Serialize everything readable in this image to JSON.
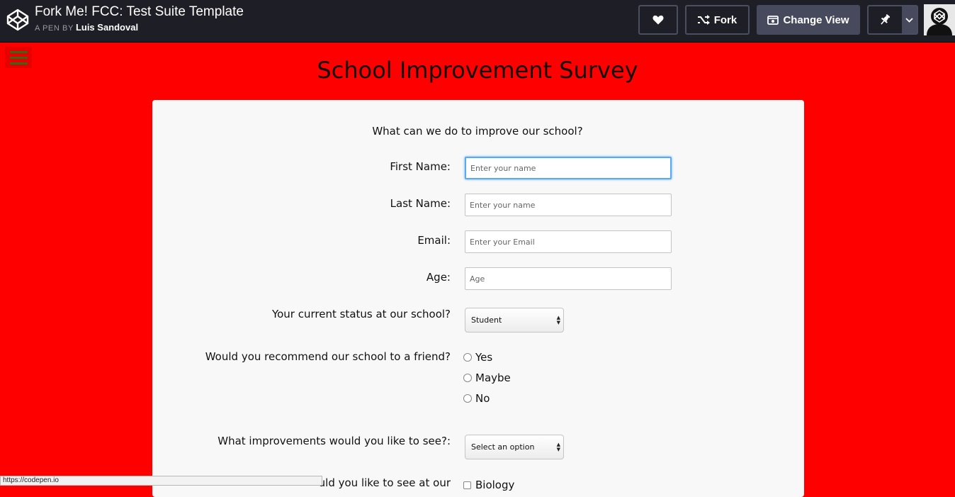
{
  "codepen": {
    "pen_title": "Fork Me! FCC: Test Suite Template",
    "by_prefix": "A PEN BY",
    "author": "Luis Sandoval",
    "fork_label": "Fork",
    "change_view_label": "Change View"
  },
  "survey": {
    "title": "School Improvement Survey",
    "description": "What can we do to improve our school?",
    "fields": {
      "first_name": {
        "label": "First Name:",
        "placeholder": "Enter your name"
      },
      "last_name": {
        "label": "Last Name:",
        "placeholder": "Enter your name"
      },
      "email": {
        "label": "Email:",
        "placeholder": "Enter your Email"
      },
      "age": {
        "label": "Age:",
        "placeholder": "Age"
      }
    },
    "status": {
      "label": "Your current status at our school?",
      "selected": "Student"
    },
    "recommend": {
      "label": "Would you recommend our school to a friend?",
      "options": [
        "Yes",
        "Maybe",
        "No"
      ]
    },
    "improvements": {
      "label": "What improvements would you like to see?:",
      "selected": "Select an option"
    },
    "subjects": {
      "label_partial": "uld you like to see at our",
      "first_option": "Biology"
    }
  },
  "browser": {
    "status_url": "https://codepen.io"
  },
  "colors": {
    "page_background": "#ff0000",
    "card_background": "#f8f8f8",
    "topbar": "#1e1f26",
    "focus_ring": "#5aaaf3"
  }
}
